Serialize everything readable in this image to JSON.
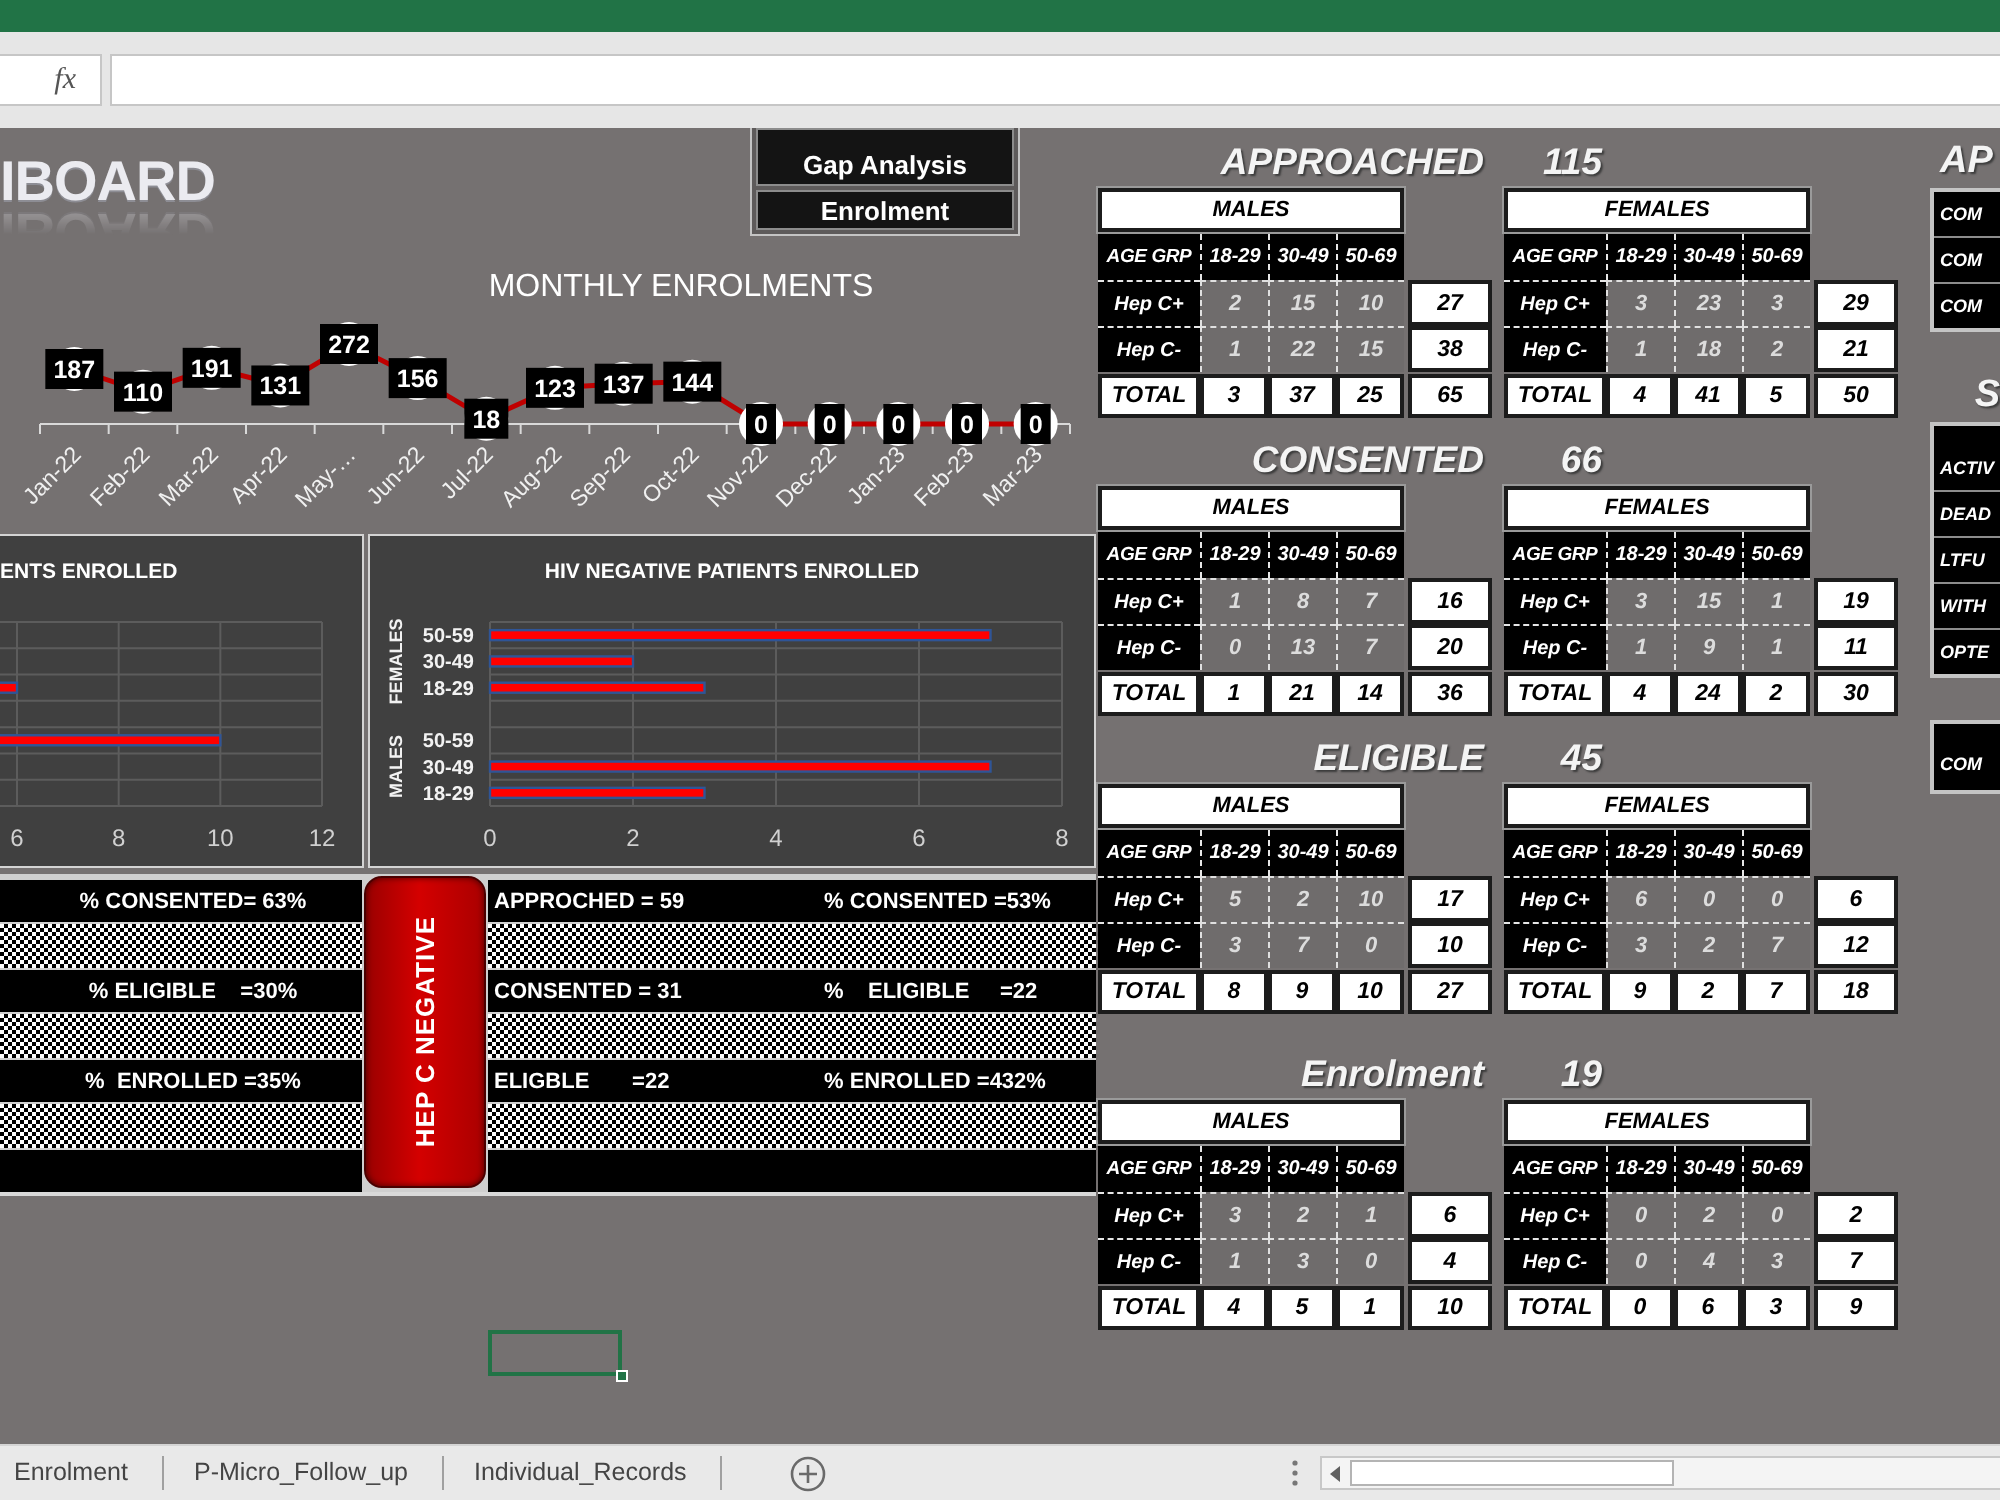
{
  "formula_bar": {
    "function_label": "fx"
  },
  "header": {
    "title": "IBOARD",
    "nav_buttons": [
      "Gap Analysis",
      "Enrolment"
    ]
  },
  "monthly_enrolments": {
    "title": "MONTHLY ENROLMENTS",
    "chart_data": {
      "type": "line",
      "categories": [
        "Jan-22",
        "Feb-22",
        "Mar-22",
        "Apr-22",
        "May-…",
        "Jun-22",
        "Jul-22",
        "Aug-22",
        "Sep-22",
        "Oct-22",
        "Nov-22",
        "Dec-22",
        "Jan-23",
        "Feb-23",
        "Mar-23"
      ],
      "series": [
        {
          "color": "#c00000",
          "marker": "circle",
          "values": [
            187,
            110,
            191,
            131,
            272,
            156,
            18,
            123,
            137,
            144,
            0,
            0,
            0,
            0,
            0
          ]
        }
      ],
      "data_labels": true
    }
  },
  "enrolled_charts": [
    {
      "title": "ENTS ENROLLED",
      "chart_data": {
        "type": "bar",
        "orientation": "horizontal",
        "grid": true,
        "series": [
          {
            "color": "#ff0000",
            "values": [
              null,
              null,
              6,
              10,
              null,
              null
            ]
          }
        ],
        "xlim": [
          0,
          12
        ],
        "xticks": [
          6,
          8,
          10,
          12
        ]
      }
    },
    {
      "title": "HIV NEGATIVE PATIENTS ENROLLED",
      "group_labels": [
        "FEMALES",
        "MALES"
      ],
      "chart_data": {
        "type": "bar",
        "orientation": "horizontal",
        "grid": true,
        "categories": [
          "50-59",
          "30-49",
          "18-29",
          "50-59",
          "30-49",
          "18-29"
        ],
        "series": [
          {
            "color": "#ff0000",
            "values": [
              7,
              2,
              3,
              0,
              7,
              3
            ]
          }
        ],
        "xlim": [
          0,
          8
        ],
        "xticks": [
          0,
          2,
          4,
          6,
          8
        ]
      }
    }
  ],
  "hep_c_summary": {
    "left_rows": [
      "% CONSENTED= 63%",
      "% ELIGIBLE    =30%",
      "%  ENROLLED =35%"
    ],
    "banner": "HEP C NEGATIVE",
    "right_rows": [
      {
        "count": "APPROCHED = 59",
        "rate": "% CONSENTED =53%"
      },
      {
        "count": "CONSENTED = 31",
        "rate": "%    ELIGIBLE     =22"
      },
      {
        "count": "ELIGBLE       =22",
        "rate": "% ENROLLED =432%"
      }
    ]
  },
  "sections": [
    {
      "title": "APPROACHED",
      "count": "115",
      "tables": [
        {
          "header": "MALES",
          "age_label": "AGE GRP",
          "age_groups": [
            "18-29",
            "30-49",
            "50-69"
          ],
          "rows": [
            {
              "kind": "hep",
              "label": "Hep C+",
              "values": [
                "2",
                "15",
                "10"
              ],
              "total": "27"
            },
            {
              "kind": "hep",
              "label": "Hep C-",
              "values": [
                "1",
                "22",
                "15"
              ],
              "total": "38"
            },
            {
              "kind": "total",
              "label": "TOTAL",
              "values": [
                "3",
                "37",
                "25"
              ],
              "total": "65"
            }
          ]
        },
        {
          "header": "FEMALES",
          "age_label": "AGE GRP",
          "age_groups": [
            "18-29",
            "30-49",
            "50-69"
          ],
          "rows": [
            {
              "kind": "hep",
              "label": "Hep C+",
              "values": [
                "3",
                "23",
                "3"
              ],
              "total": "29"
            },
            {
              "kind": "hep",
              "label": "Hep C-",
              "values": [
                "1",
                "18",
                "2"
              ],
              "total": "21"
            },
            {
              "kind": "total",
              "label": "TOTAL",
              "values": [
                "4",
                "41",
                "5"
              ],
              "total": "50"
            }
          ]
        }
      ]
    },
    {
      "title": "CONSENTED",
      "count": "66",
      "tables": [
        {
          "header": "MALES",
          "age_label": "AGE GRP",
          "age_groups": [
            "18-29",
            "30-49",
            "50-69"
          ],
          "rows": [
            {
              "kind": "hep",
              "label": "Hep C+",
              "values": [
                "1",
                "8",
                "7"
              ],
              "total": "16"
            },
            {
              "kind": "hep",
              "label": "Hep C-",
              "values": [
                "0",
                "13",
                "7"
              ],
              "total": "20"
            },
            {
              "kind": "total",
              "label": "TOTAL",
              "values": [
                "1",
                "21",
                "14"
              ],
              "total": "36"
            }
          ]
        },
        {
          "header": "FEMALES",
          "age_label": "AGE GRP",
          "age_groups": [
            "18-29",
            "30-49",
            "50-69"
          ],
          "rows": [
            {
              "kind": "hep",
              "label": "Hep C+",
              "values": [
                "3",
                "15",
                "1"
              ],
              "total": "19"
            },
            {
              "kind": "hep",
              "label": "Hep C-",
              "values": [
                "1",
                "9",
                "1"
              ],
              "total": "11"
            },
            {
              "kind": "total",
              "label": "TOTAL",
              "values": [
                "4",
                "24",
                "2"
              ],
              "total": "30"
            }
          ]
        }
      ]
    },
    {
      "title": "ELIGIBLE",
      "count": "45",
      "tables": [
        {
          "header": "MALES",
          "age_label": "AGE GRP",
          "age_groups": [
            "18-29",
            "30-49",
            "50-69"
          ],
          "rows": [
            {
              "kind": "hep",
              "label": "Hep C+",
              "values": [
                "5",
                "2",
                "10"
              ],
              "total": "17"
            },
            {
              "kind": "hep",
              "label": "Hep C-",
              "values": [
                "3",
                "7",
                "0"
              ],
              "total": "10"
            },
            {
              "kind": "total",
              "label": "TOTAL",
              "values": [
                "8",
                "9",
                "10"
              ],
              "total": "27"
            }
          ]
        },
        {
          "header": "FEMALES",
          "age_label": "AGE GRP",
          "age_groups": [
            "18-29",
            "30-49",
            "50-69"
          ],
          "rows": [
            {
              "kind": "hep",
              "label": "Hep C+",
              "values": [
                "6",
                "0",
                "0"
              ],
              "total": "6"
            },
            {
              "kind": "hep",
              "label": "Hep C-",
              "values": [
                "3",
                "2",
                "7"
              ],
              "total": "12"
            },
            {
              "kind": "total",
              "label": "TOTAL",
              "values": [
                "9",
                "2",
                "7"
              ],
              "total": "18"
            }
          ]
        }
      ]
    },
    {
      "title": "Enrolment",
      "count": "19",
      "tables": [
        {
          "header": "MALES",
          "age_label": "AGE GRP",
          "age_groups": [
            "18-29",
            "30-49",
            "50-69"
          ],
          "rows": [
            {
              "kind": "hep",
              "label": "Hep C+",
              "values": [
                "3",
                "2",
                "1"
              ],
              "total": "6"
            },
            {
              "kind": "hep",
              "label": "Hep C-",
              "values": [
                "1",
                "3",
                "0"
              ],
              "total": "4"
            },
            {
              "kind": "total",
              "label": "TOTAL",
              "values": [
                "4",
                "5",
                "1"
              ],
              "total": "10"
            }
          ]
        },
        {
          "header": "FEMALES",
          "age_label": "AGE GRP",
          "age_groups": [
            "18-29",
            "30-49",
            "50-69"
          ],
          "rows": [
            {
              "kind": "hep",
              "label": "Hep C+",
              "values": [
                "0",
                "2",
                "0"
              ],
              "total": "2"
            },
            {
              "kind": "hep",
              "label": "Hep C-",
              "values": [
                "0",
                "4",
                "3"
              ],
              "total": "7"
            },
            {
              "kind": "total",
              "label": "TOTAL",
              "values": [
                "0",
                "6",
                "3"
              ],
              "total": "9"
            }
          ]
        }
      ]
    }
  ],
  "side_panel": {
    "title": "AP",
    "top_rows": [
      "COM",
      "COM",
      "COM"
    ],
    "status_title": "S",
    "status_rows": [
      "ACTIV",
      "DEAD",
      "LTFU",
      "WITH",
      "OPTE"
    ],
    "bottom_rows": [
      "COM"
    ]
  },
  "sheet_tabs": [
    {
      "label": "Enrolment",
      "selected": false
    },
    {
      "label": "P-Micro_Follow_up",
      "selected": false
    },
    {
      "label": "Individual_Records",
      "selected": false
    }
  ]
}
